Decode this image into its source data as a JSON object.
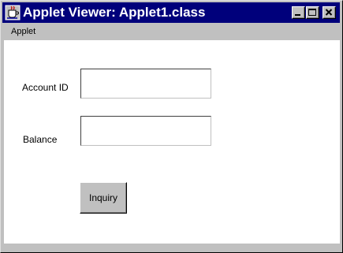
{
  "window": {
    "title": "Applet Viewer: Applet1.class",
    "controls": {
      "minimize_icon": "minimize-icon",
      "maximize_icon": "maximize-icon",
      "close_icon": "close-icon"
    }
  },
  "menubar": {
    "items": [
      {
        "label": "Applet"
      }
    ]
  },
  "form": {
    "account_id": {
      "label": "Account ID",
      "value": ""
    },
    "balance": {
      "label": "Balance",
      "value": ""
    },
    "inquiry_button": {
      "label": "Inquiry"
    }
  },
  "colors": {
    "titlebar": "#00007b",
    "chrome": "#c0c0c0",
    "client": "#ffffff"
  }
}
